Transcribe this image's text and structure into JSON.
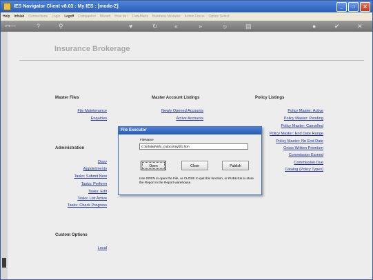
{
  "window": {
    "title": "IES Navigator Client v8.03 : My IES :      [mode-Z]",
    "buttons": {
      "minimize": "_",
      "maximize": "□",
      "close": "✕"
    }
  },
  "menu": {
    "items": [
      {
        "label": "Help",
        "enabled": true
      },
      {
        "label": "Infolab",
        "enabled": true
      },
      {
        "label": "Connections",
        "enabled": false
      },
      {
        "label": "Login",
        "enabled": false
      },
      {
        "label": "Logoff",
        "enabled": true
      },
      {
        "label": "Companion",
        "enabled": false
      },
      {
        "label": "Wizard",
        "enabled": false
      },
      {
        "label": "How do I",
        "enabled": false
      },
      {
        "label": "DataMarts",
        "enabled": false
      },
      {
        "label": "Business Modules",
        "enabled": false
      },
      {
        "label": "Action Focus",
        "enabled": false
      },
      {
        "label": "Option Select",
        "enabled": false
      }
    ]
  },
  "toolbar": {
    "icons": [
      "key-icon",
      "help-icon",
      "search-icon",
      "heart-icon",
      "refresh-icon",
      "back-icon",
      "forward-icon",
      "stop-icon",
      "save-icon",
      "info-icon",
      "check-icon",
      "close-icon"
    ]
  },
  "page": {
    "heading": "Insurance Brokerage"
  },
  "sections": {
    "master_files": {
      "title": "Master Files",
      "links": [
        "File Maintenance",
        "Enquiries"
      ]
    },
    "master_listings": {
      "title": "Master Account Listings",
      "links": [
        "Newly Opened Accounts",
        "Active Accounts"
      ]
    },
    "policy_listings": {
      "title": "Policy Listings",
      "links": [
        "Policy Master: Active",
        "Policy Master: Pending",
        "Policy Master: Cancelled",
        "Policy Master: End Date Range",
        "Policy Master: No End Date",
        "Gross Written Premium",
        "Commission Earned",
        "Commission Due",
        "Catalog (Policy Types)"
      ]
    },
    "administration": {
      "title": "Administration",
      "links": [
        "Diary",
        "Appointments",
        "Tasks: Submit New",
        "Tasks: Perform",
        "Tasks: Edit",
        "Tasks: List Active",
        "Tasks: Check Progress"
      ]
    },
    "custom_options": {
      "title": "Custom Options",
      "links": [
        "Local"
      ]
    }
  },
  "dialog": {
    "title": "File Executor",
    "field_label": "FileName",
    "file_value": "C:\\infolab\\info_c\\docs\\my\\tf1.htm",
    "open_label": "Open",
    "close_label": "Close",
    "publish_label": "Publish",
    "note": "Use OPEN to open the File, or CLOSE to quit this function, or PUBLISH to store the Report in the Report warehouse."
  }
}
